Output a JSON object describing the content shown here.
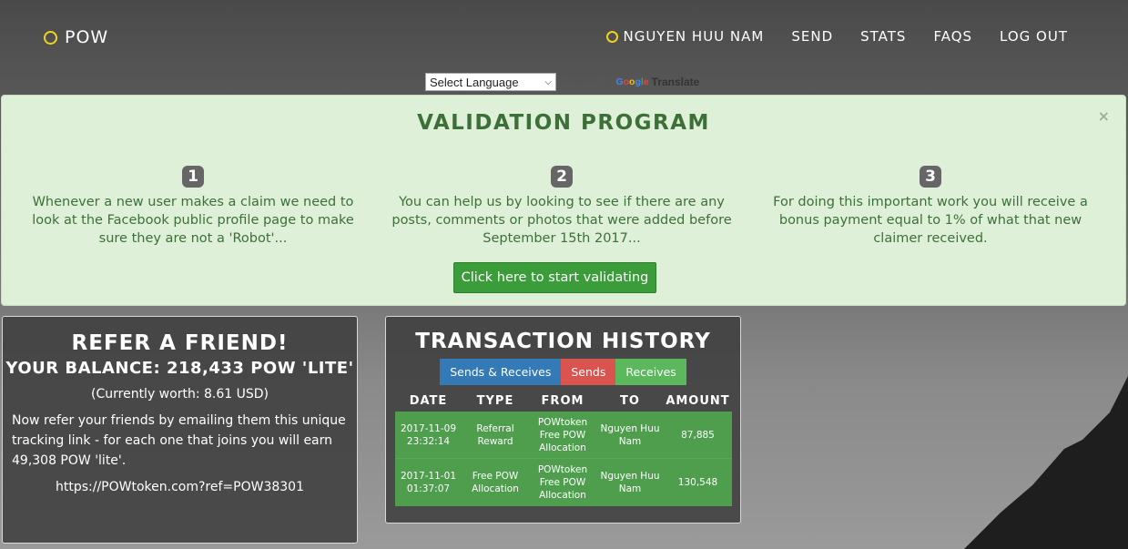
{
  "nav": {
    "brand": "POW",
    "user": "NGUYEN HUU NAM",
    "links": [
      "SEND",
      "STATS",
      "FAQS",
      "LOG OUT"
    ]
  },
  "translate": {
    "select_value": "Select Language",
    "powered_by": "Powered by",
    "google": "Google",
    "translate_label": "Translate"
  },
  "validation": {
    "title": "VALIDATION PROGRAM",
    "close": "×",
    "steps": [
      {
        "num": "1",
        "text": "Whenever a new user makes a claim we need to look at the Facebook public profile page to make sure they are not a 'Robot'..."
      },
      {
        "num": "2",
        "text": "You can help us by looking to see if there are any posts, comments or photos that were added before September 15th 2017..."
      },
      {
        "num": "3",
        "text": "For doing this important work you will receive a bonus payment equal to 1% of what that new claimer received."
      }
    ],
    "button": "Click here to start validating"
  },
  "refer": {
    "title": "REFER A FRIEND!",
    "balance": "YOUR BALANCE: 218,433 POW 'LITE'",
    "worth": "(Currently worth: 8.61 USD)",
    "description": "Now refer your friends by emailing them this unique tracking link - for each one that joins you will earn 49,308 POW 'lite'.",
    "link": "https://POWtoken.com?ref=POW38301"
  },
  "transactions": {
    "title": "TRANSACTION HISTORY",
    "tabs": [
      "Sends & Receives",
      "Sends",
      "Receives"
    ],
    "columns": [
      "DATE",
      "TYPE",
      "FROM",
      "TO",
      "AMOUNT"
    ],
    "rows": [
      {
        "date": "2017-11-09 23:32:14",
        "type": "Referral Reward",
        "from": "POWtoken Free POW Allocation",
        "to": "Nguyen Huu Nam",
        "amount": "87,885"
      },
      {
        "date": "2017-11-01 01:37:07",
        "type": "Free POW Allocation",
        "from": "POWtoken Free POW Allocation",
        "to": "Nguyen Huu Nam",
        "amount": "130,548"
      }
    ]
  },
  "colors": {
    "accent_yellow": "#f2d21e",
    "banner_bg": "#dff0d8",
    "banner_text": "#3c7038",
    "button_green": "#3b9d3a",
    "tab_blue": "#337ab7",
    "tab_red": "#d9534f",
    "tab_green": "#5cb85c"
  }
}
